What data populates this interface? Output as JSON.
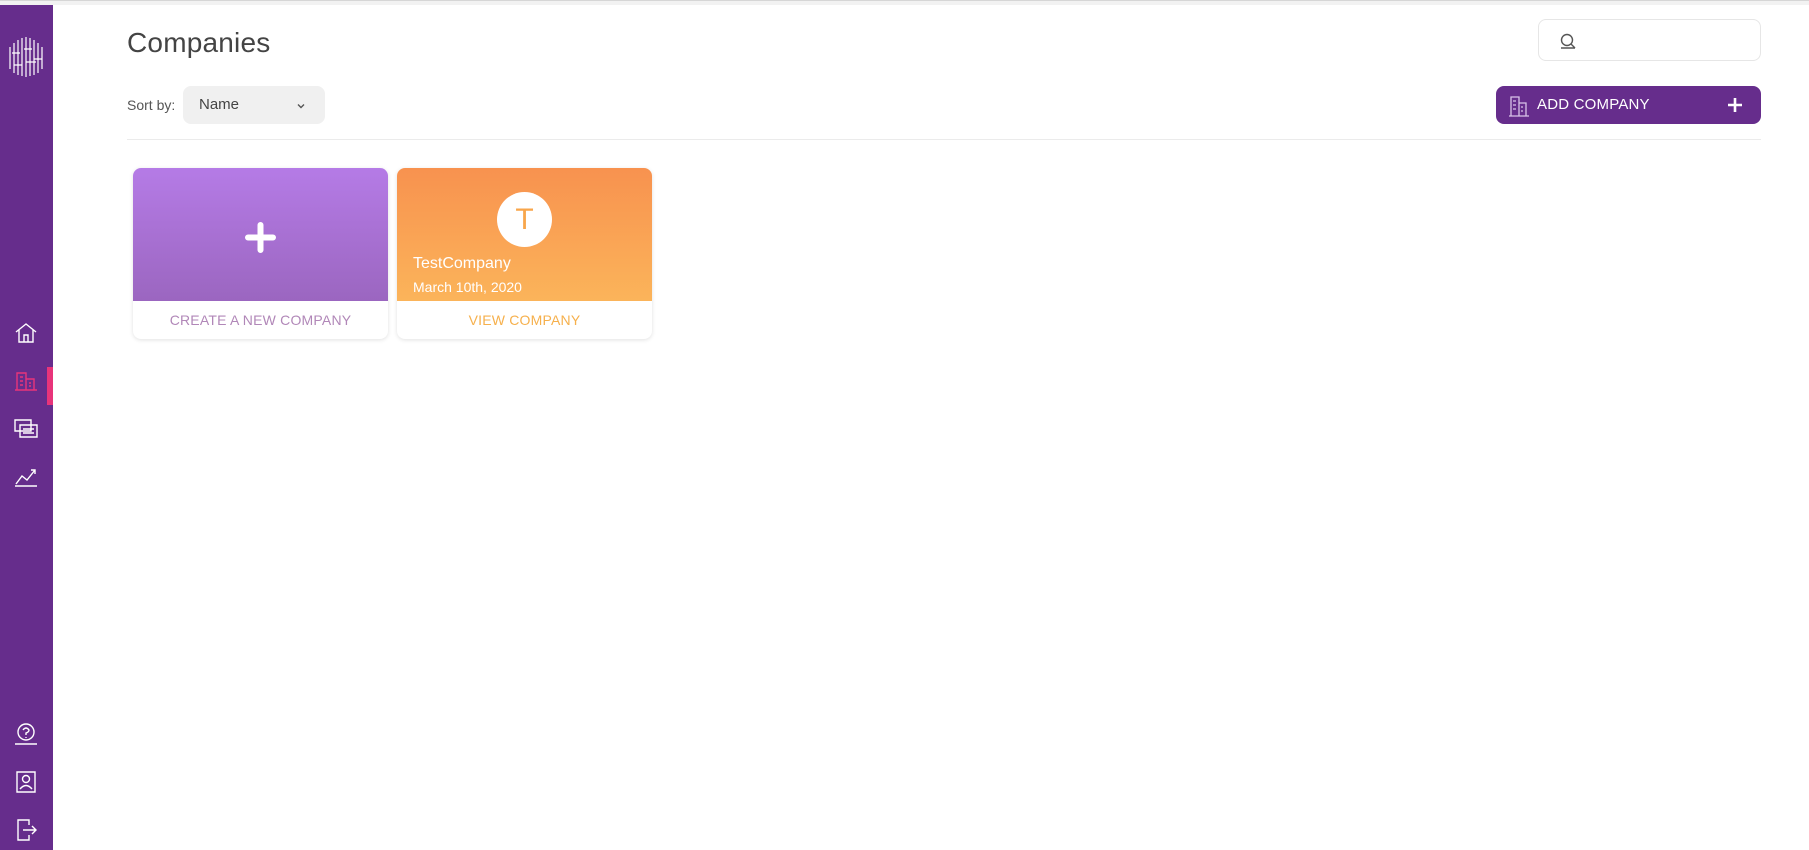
{
  "header": {
    "title": "Companies",
    "search_placeholder": ""
  },
  "toolbar": {
    "sort_label": "Sort by:",
    "sort_value": "Name",
    "add_company_label": "ADD COMPANY"
  },
  "sidebar": {
    "items": [
      {
        "name": "home",
        "icon": "home-icon",
        "active": false
      },
      {
        "name": "companies",
        "icon": "building-icon",
        "active": true
      },
      {
        "name": "messages",
        "icon": "screens-icon",
        "active": false
      },
      {
        "name": "analytics",
        "icon": "chart-icon",
        "active": false
      }
    ],
    "bottom_items": [
      {
        "name": "help",
        "icon": "help-icon"
      },
      {
        "name": "profile",
        "icon": "profile-icon"
      },
      {
        "name": "logout",
        "icon": "logout-icon"
      }
    ]
  },
  "cards": {
    "new_company": {
      "action_label": "CREATE A NEW COMPANY"
    },
    "company": {
      "initial": "T",
      "name": "TestCompany",
      "date": "March 10th, 2020",
      "action_label": "VIEW COMPANY"
    }
  },
  "colors": {
    "sidebar": "#662d8c",
    "active_indicator": "#e8347a",
    "new_card_gradient": [
      "#b57be6",
      "#9b66c0"
    ],
    "company_card_gradient": [
      "#f8924f",
      "#fbb45a"
    ]
  }
}
